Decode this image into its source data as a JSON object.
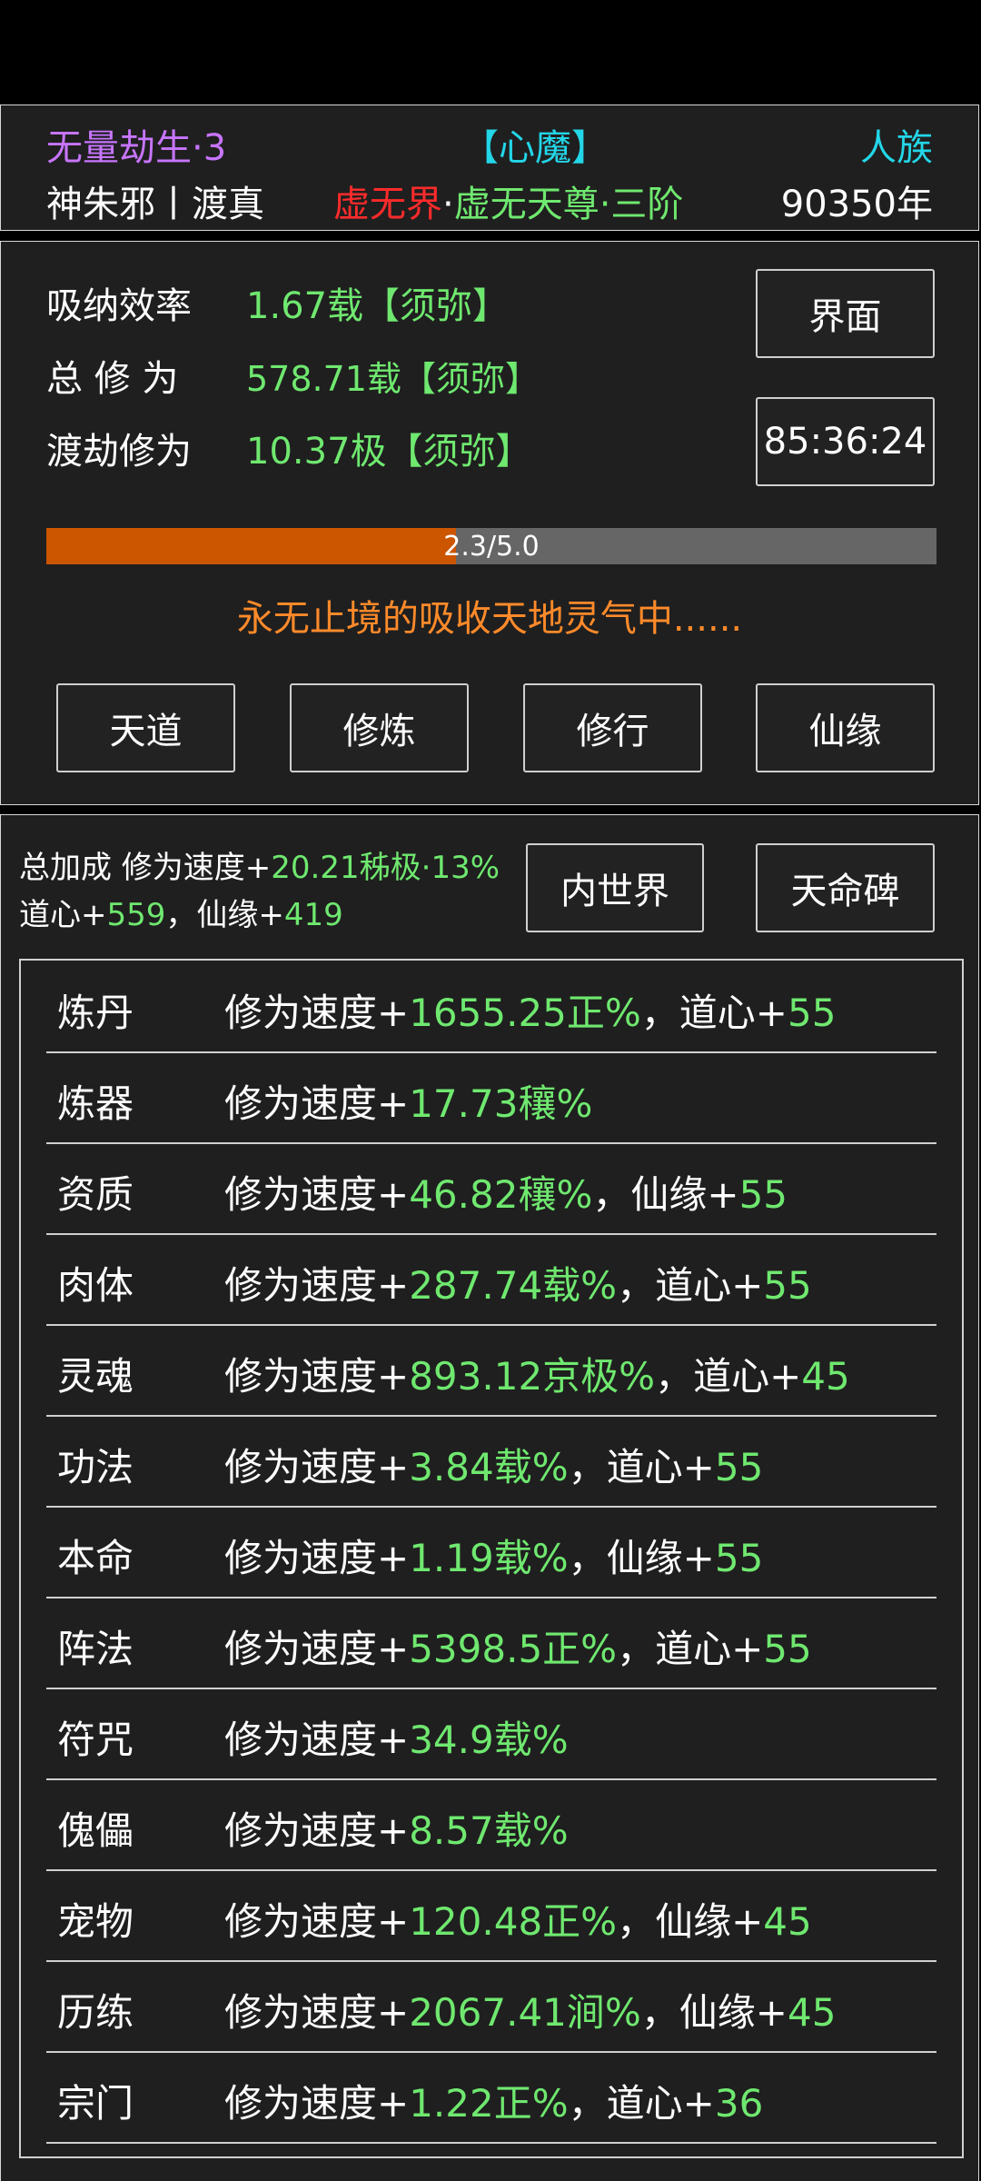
{
  "header": {
    "title_left": "无量劫生·3",
    "title_center": "【心魔】",
    "title_right": "人族",
    "name": "神朱邪丨渡真",
    "realm_red": "虚无界",
    "realm_sep": "·",
    "realm_green": "虚无天尊·三阶",
    "years": "90350年"
  },
  "stats": {
    "absorb_label": "吸纳效率",
    "absorb_value": "1.67载【须弥】",
    "total_label": "总 修 为",
    "total_value": "578.71载【须弥】",
    "tribulation_label": "渡劫修为",
    "tribulation_value": "10.37极【须弥】",
    "interface_button": "界面",
    "timer": "85:36:24",
    "progress_text": "2.3/5.0",
    "progress_fraction": 0.46,
    "status_message": "永无止境的吸收天地灵气中......"
  },
  "nav_buttons": [
    "天道",
    "修炼",
    "修行",
    "仙缘"
  ],
  "bonus": {
    "summary_label": "总加成 修为速度+",
    "summary_value": "20.21秭极·13%",
    "daoxin_label": "道心+",
    "daoxin_value": "559",
    "xianyuan_sep": "，仙缘+",
    "xianyuan_value": "419",
    "inner_world_button": "内世界",
    "destiny_button": "天命碑"
  },
  "rows": [
    {
      "name": "炼丹",
      "prefix": "修为速度+",
      "value": "1655.25正%",
      "extra_label": "，道心+",
      "extra_value": "55"
    },
    {
      "name": "炼器",
      "prefix": "修为速度+",
      "value": "17.73穰%",
      "extra_label": "",
      "extra_value": ""
    },
    {
      "name": "资质",
      "prefix": "修为速度+",
      "value": "46.82穰%",
      "extra_label": "，仙缘+",
      "extra_value": "55"
    },
    {
      "name": "肉体",
      "prefix": "修为速度+",
      "value": "287.74载%",
      "extra_label": "，道心+",
      "extra_value": "55"
    },
    {
      "name": "灵魂",
      "prefix": "修为速度+",
      "value": "893.12京极%",
      "extra_label": "，道心+",
      "extra_value": "45"
    },
    {
      "name": "功法",
      "prefix": "修为速度+",
      "value": "3.84载%",
      "extra_label": "，道心+",
      "extra_value": "55"
    },
    {
      "name": "本命",
      "prefix": "修为速度+",
      "value": "1.19载%",
      "extra_label": "，仙缘+",
      "extra_value": "55"
    },
    {
      "name": "阵法",
      "prefix": "修为速度+",
      "value": "5398.5正%",
      "extra_label": "，道心+",
      "extra_value": "55"
    },
    {
      "name": "符咒",
      "prefix": "修为速度+",
      "value": "34.9载%",
      "extra_label": "",
      "extra_value": ""
    },
    {
      "name": "傀儡",
      "prefix": "修为速度+",
      "value": "8.57载%",
      "extra_label": "",
      "extra_value": ""
    },
    {
      "name": "宠物",
      "prefix": "修为速度+",
      "value": "120.48正%",
      "extra_label": "，仙缘+",
      "extra_value": "45"
    },
    {
      "name": "历练",
      "prefix": "修为速度+",
      "value": "2067.41涧%",
      "extra_label": "，仙缘+",
      "extra_value": "45"
    },
    {
      "name": "宗门",
      "prefix": "修为速度+",
      "value": "1.22正%",
      "extra_label": "，道心+",
      "extra_value": "36"
    }
  ]
}
